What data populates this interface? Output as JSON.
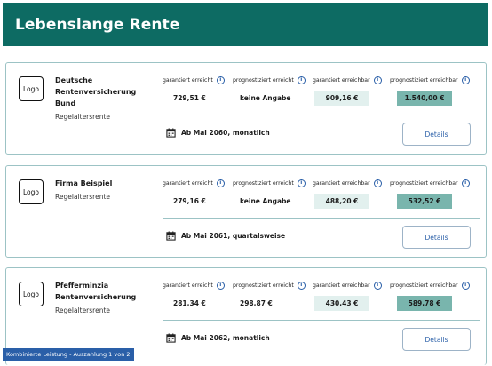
{
  "page": {
    "title": "Lebenslange Rente"
  },
  "labels": {
    "guaranteed_reached": "garantiert erreicht",
    "forecast_reached": "prognostiziert erreicht",
    "guaranteed_reachable": "garantiert erreichbar",
    "forecast_reachable": "prognostiziert erreichbar",
    "info_glyph": "i",
    "details": "Details",
    "logo": "Logo"
  },
  "cards": [
    {
      "provider": "Deutsche Rentenversicherung Bund",
      "type": "Regelaltersrente",
      "guaranteed_reached": "729,51 €",
      "forecast_reached": "keine Angabe",
      "guaranteed_reachable": "909,16 €",
      "forecast_reachable": "1.540,00 €",
      "schedule": "Ab Mai 2060, monatlich"
    },
    {
      "provider": "Firma Beispiel",
      "type": "Regelaltersrente",
      "guaranteed_reached": "279,16 €",
      "forecast_reached": "keine Angabe",
      "guaranteed_reachable": "488,20 €",
      "forecast_reachable": "532,52 €",
      "schedule": "Ab Mai 2061, quartalsweise"
    },
    {
      "provider": "Pfefferminzia Rentenversicherung",
      "type": "Regelaltersrente",
      "guaranteed_reached": "281,34 €",
      "forecast_reached": "298,87 €",
      "guaranteed_reachable": "430,43 €",
      "forecast_reachable": "589,78 €",
      "schedule": "Ab Mai 2062, monatlich",
      "badge": "Kombinierte Leistung - Auszahlung 1 von 2"
    }
  ],
  "colors": {
    "header_bg": "#0d6b63",
    "guaranteed_reachable_bg": "#e2f0ee",
    "forecast_reachable_bg": "#79b5ad",
    "link_blue": "#2a5fa8",
    "card_border": "#9cc3c5"
  },
  "icons": {
    "info": "info-icon",
    "calendar": "calendar-icon"
  }
}
